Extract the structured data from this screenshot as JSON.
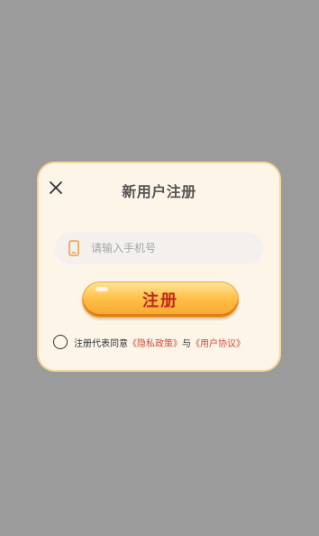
{
  "dialog": {
    "title": "新用户注册",
    "phone_placeholder": "请输入手机号",
    "register_label": "注册",
    "agreement": {
      "prefix": "注册代表同意",
      "privacy_link": "《隐私政策》",
      "conjunction": "与",
      "user_link": "《用户协议》",
      "checked": false
    }
  },
  "colors": {
    "backdrop": "#9b9b9b",
    "dialog_bg": "#fdf5e8",
    "dialog_border": "#f3d49b",
    "button_top": "#ffe49a",
    "button_bottom": "#f7a52e",
    "button_text": "#c0281a",
    "link": "#d04a3a",
    "phone_icon": "#f0a040"
  },
  "icons": {
    "close": "close-icon",
    "phone": "phone-icon"
  }
}
